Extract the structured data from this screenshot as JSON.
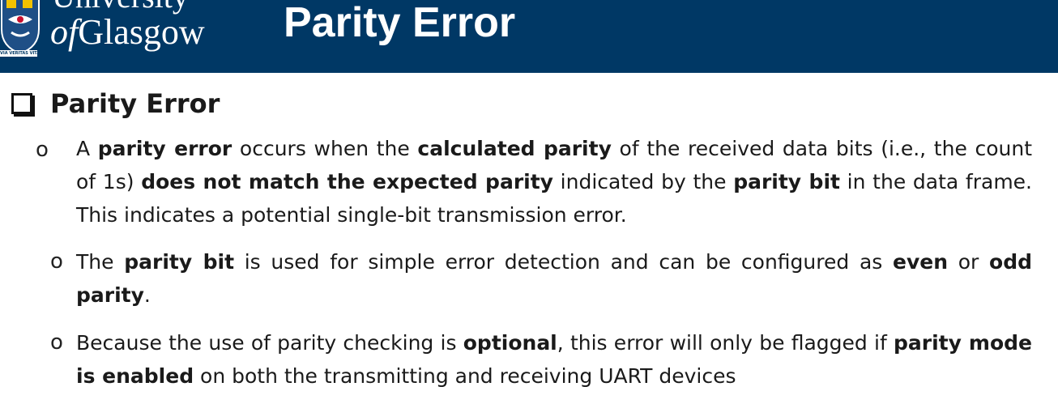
{
  "header": {
    "logo": {
      "line1": "University",
      "line2_of": "of",
      "line2_name": "Glasgow",
      "motto": "VIA VERITAS VITA"
    },
    "title": "Parity Error"
  },
  "section": {
    "title": "Parity Error"
  },
  "bullets": [
    {
      "marker": "o",
      "segments": [
        {
          "t": "A ",
          "b": false
        },
        {
          "t": "parity error",
          "b": true
        },
        {
          "t": " occurs when the ",
          "b": false
        },
        {
          "t": "calculated parity",
          "b": true
        },
        {
          "t": " of the received data bits (i.e., the count of 1s) ",
          "b": false
        },
        {
          "t": "does not match the expected parity",
          "b": true
        },
        {
          "t": " indicated by the ",
          "b": false
        },
        {
          "t": "parity bit",
          "b": true
        },
        {
          "t": " in the data frame. This indicates a potential single-bit transmission error.",
          "b": false
        }
      ]
    },
    {
      "marker": "o",
      "segments": [
        {
          "t": "The ",
          "b": false
        },
        {
          "t": "parity bit",
          "b": true
        },
        {
          "t": " is used for simple error detection and can be configured as ",
          "b": false
        },
        {
          "t": "even",
          "b": true
        },
        {
          "t": " or ",
          "b": false
        },
        {
          "t": "odd parity",
          "b": true
        },
        {
          "t": ".",
          "b": false
        }
      ]
    },
    {
      "marker": "o",
      "segments": [
        {
          "t": "Because the use of parity checking is ",
          "b": false
        },
        {
          "t": "optional",
          "b": true
        },
        {
          "t": ", this error will only be flagged if ",
          "b": false
        },
        {
          "t": "parity mode is enabled",
          "b": true
        },
        {
          "t": " on both the transmitting and receiving UART devices",
          "b": false
        }
      ]
    }
  ],
  "colors": {
    "header_bg": "#003865",
    "text": "#1a1a1a"
  }
}
